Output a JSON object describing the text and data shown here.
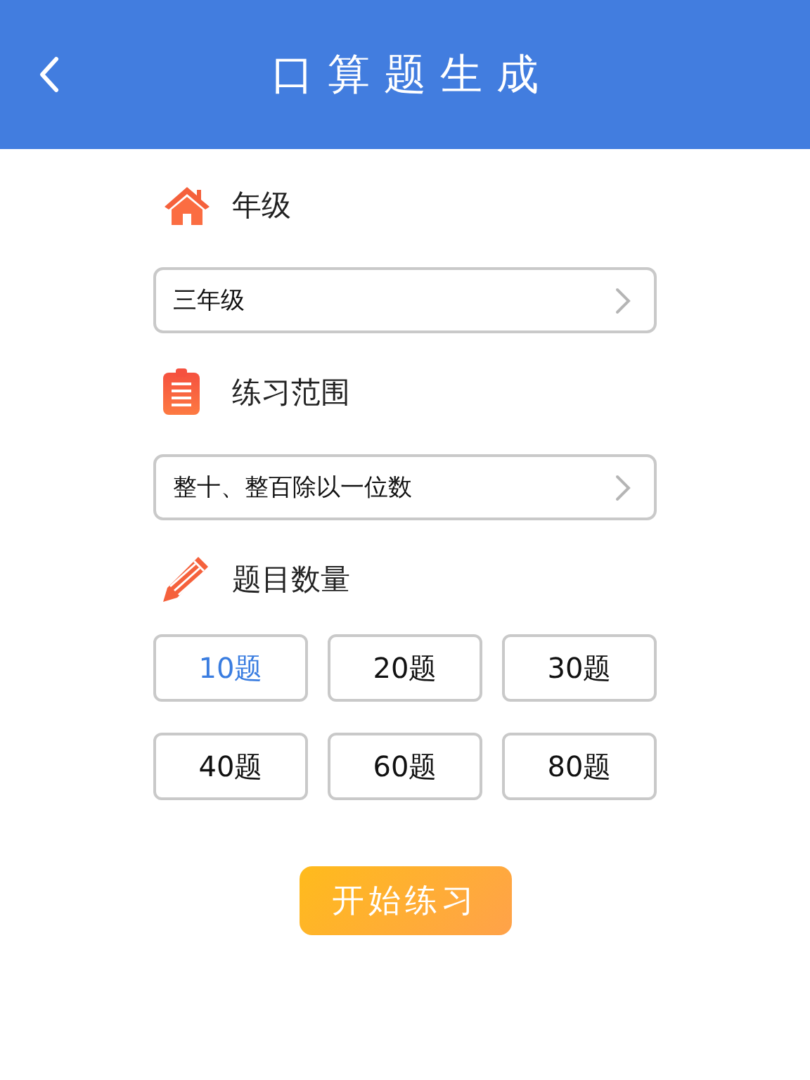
{
  "header": {
    "title": "口算题生成"
  },
  "sections": [
    {
      "title": "年级",
      "select": {
        "value": "三年级"
      }
    },
    {
      "title": "练习范围",
      "select": {
        "value": "整十、整百除以一位数"
      }
    },
    {
      "title": "题目数量",
      "options": [
        {
          "label": "10题",
          "selected": true
        },
        {
          "label": "20题",
          "selected": false
        },
        {
          "label": "30题",
          "selected": false
        },
        {
          "label": "40题",
          "selected": false
        },
        {
          "label": "60题",
          "selected": false
        },
        {
          "label": "80题",
          "selected": false
        }
      ]
    }
  ],
  "start_button": "开始练习"
}
